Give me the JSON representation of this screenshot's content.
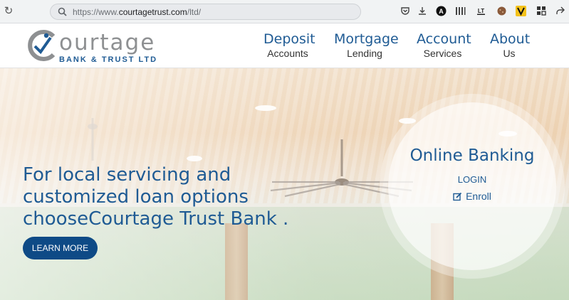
{
  "browser": {
    "url_prefix": "https://www.",
    "url_domain": "courtagetrust.com",
    "url_path": "/ltd/"
  },
  "header": {
    "logo_word": "ourtage",
    "logo_sub": "BANK & TRUST LTD",
    "nav": [
      {
        "main": "Deposit",
        "sub": "Accounts"
      },
      {
        "main": "Mortgage",
        "sub": "Lending"
      },
      {
        "main": "Account",
        "sub": "Services"
      },
      {
        "main": "About",
        "sub": "Us"
      }
    ]
  },
  "hero": {
    "title": "For local servicing and customized loan options chooseCourtage Trust Bank .",
    "button": "LEARN MORE"
  },
  "online_banking": {
    "title": "Online Banking",
    "login": "LOGIN",
    "enroll": "Enroll"
  },
  "colors": {
    "brand_blue": "#1f5b94",
    "button_blue": "#0e4a86",
    "logo_gray": "#8e9092"
  }
}
